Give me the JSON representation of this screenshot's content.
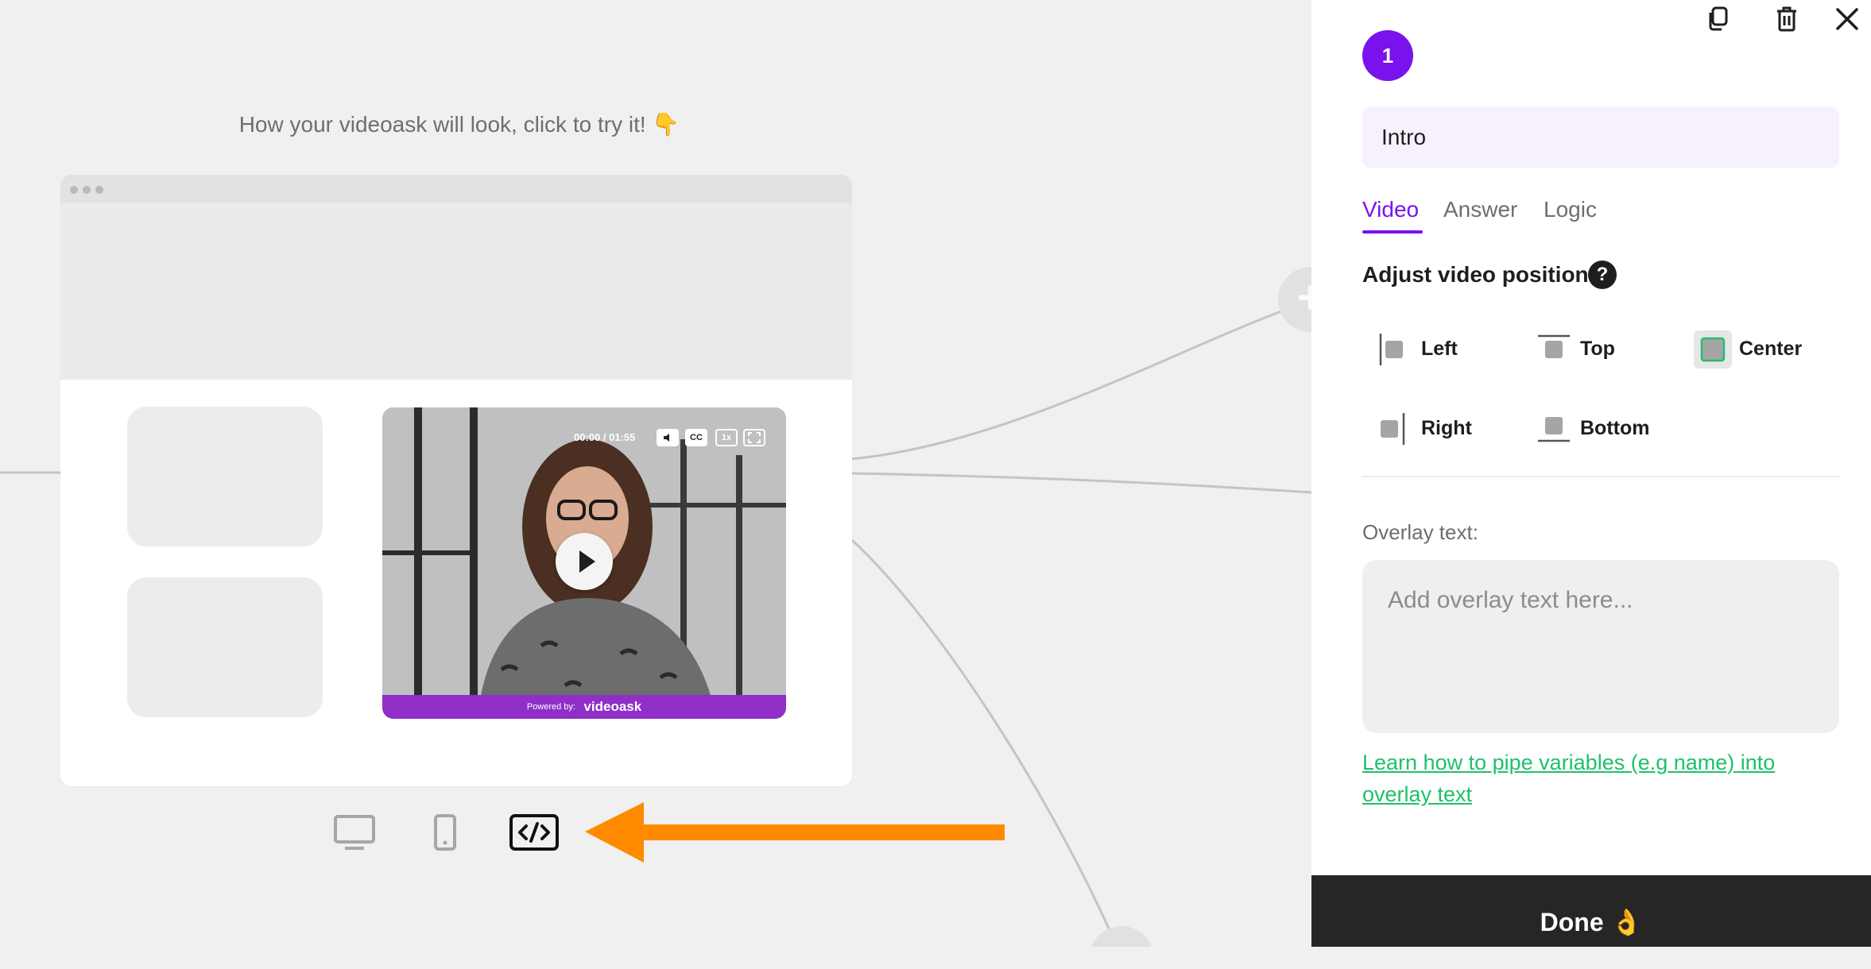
{
  "canvas": {
    "preview_hint": "How your videoask will look, click to try it! 👇",
    "plus_node_label": "+",
    "video": {
      "time": "00:00 / 01:55",
      "cc_label": "CC",
      "speed_label": "1x",
      "powered_by": "Powered by:",
      "brand": "videoask"
    },
    "devices": [
      "desktop-icon",
      "mobile-icon",
      "embed-code-icon"
    ],
    "arrow_color": "#ff8a00"
  },
  "panel": {
    "step_number": "1",
    "step_name": "Intro",
    "tabs": [
      {
        "label": "Video",
        "active": true
      },
      {
        "label": "Answer",
        "active": false
      },
      {
        "label": "Logic",
        "active": false
      }
    ],
    "section_title": "Adjust video position",
    "help_symbol": "?",
    "positions": [
      {
        "label": "Left",
        "selected": false
      },
      {
        "label": "Top",
        "selected": false
      },
      {
        "label": "Center",
        "selected": true
      },
      {
        "label": "Right",
        "selected": false
      },
      {
        "label": "Bottom",
        "selected": false
      }
    ],
    "overlay_label": "Overlay text:",
    "overlay_value": "",
    "overlay_placeholder": "Add overlay text here...",
    "help_link": "Learn how to pipe variables (e.g name) into overlay text",
    "done_label": "Done 👌"
  },
  "colors": {
    "accent": "#7a12ee",
    "link": "#1ec16a",
    "arrow": "#ff8a00",
    "done_bar": "#262626"
  }
}
